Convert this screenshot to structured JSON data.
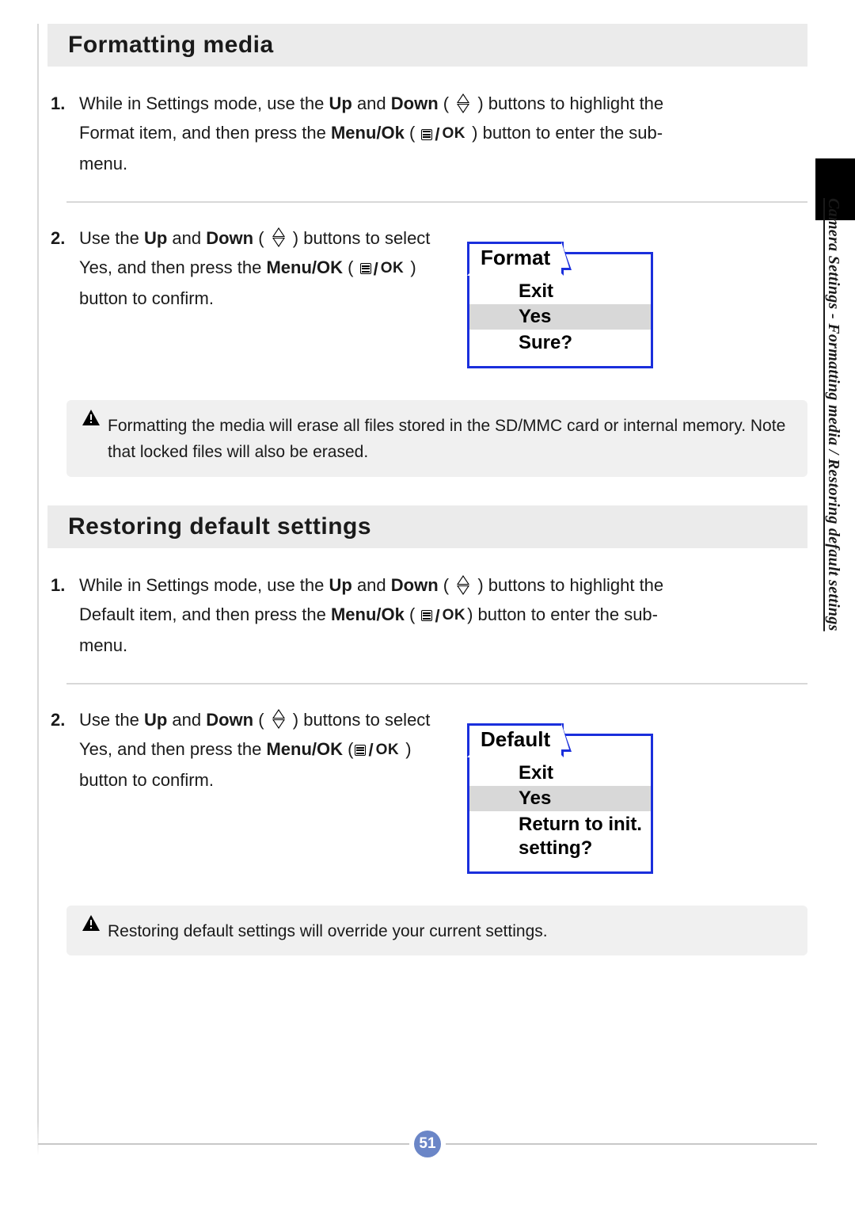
{
  "page_number": "51",
  "side_label": "Camera Settings - Formatting media / Restoring default settings",
  "section1": {
    "title": "Formatting media",
    "step1": {
      "num": "1.",
      "pre": "While in Settings mode, use the ",
      "up": "Up",
      "and": " and ",
      "down": "Down",
      "mid1": " ( ",
      "mid2": " ) buttons to highlight the Format item, and then press the ",
      "menuok": "Menu/Ok",
      "mid3": " ( ",
      "mid4": " ) button to enter the sub-menu."
    },
    "step2": {
      "num": "2.",
      "pre": "Use the ",
      "up": "Up",
      "and": " and ",
      "down": "Down",
      "mid1": " ( ",
      "mid2": " ) buttons to select Yes, and then press the ",
      "menuok": "Menu/OK",
      "mid3": " ( ",
      "mid4": " ) button to confirm."
    },
    "lcd": {
      "tab": "Format",
      "opt1": "Exit",
      "opt2": "Yes",
      "prompt": "Sure?"
    },
    "note": "Formatting the media will erase all files stored in the SD/MMC card or internal memory. Note that locked files will also be erased."
  },
  "section2": {
    "title": "Restoring default settings",
    "step1": {
      "num": "1.",
      "pre": "While in Settings mode, use the ",
      "up": "Up",
      "and": " and ",
      "down": "Down",
      "mid1": " ( ",
      "mid2": " ) buttons to highlight the Default item, and then press the ",
      "menuok": "Menu/Ok",
      "mid3": " ( ",
      "mid4": ") button to enter the sub-menu."
    },
    "step2": {
      "num": "2.",
      "pre": "Use the ",
      "up": "Up",
      "and": " and ",
      "down": "Down",
      "mid1": " ( ",
      "mid2": " ) buttons to select Yes, and then press the ",
      "menuok": "Menu/OK",
      "mid3": " (",
      "mid4": " ) button to confirm."
    },
    "lcd": {
      "tab": "Default",
      "opt1": "Exit",
      "opt2": "Yes",
      "prompt": "Return to init. setting?"
    },
    "note": "Restoring default settings will override your current settings."
  }
}
